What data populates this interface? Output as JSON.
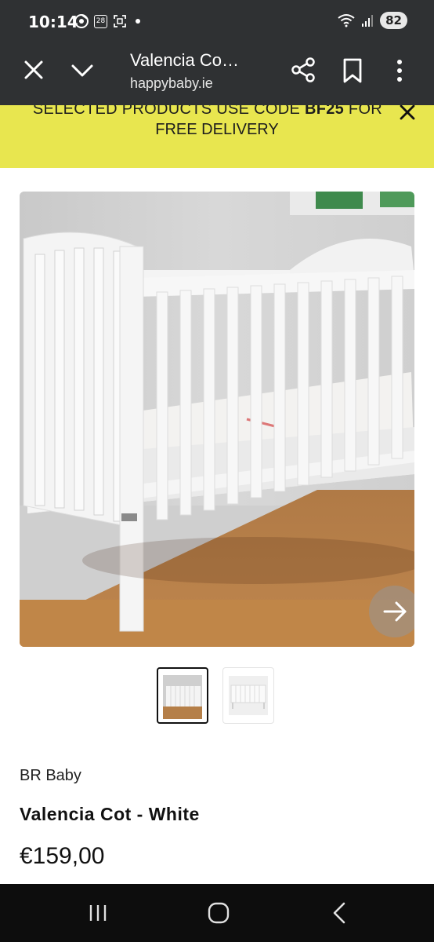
{
  "status_bar": {
    "time": "10:14",
    "calendar_day": "28",
    "battery": "82"
  },
  "browser": {
    "page_title": "Valencia Co…",
    "url": "happybaby.ie"
  },
  "promo": {
    "line1_prefix": "SELECTED PRODUCTS USE CODE ",
    "code": "BF25",
    "line1_suffix": " FOR",
    "line2": "FREE DELIVERY"
  },
  "product": {
    "brand": "BR Baby",
    "title": "Valencia Cot - White",
    "price": "€159,00"
  },
  "colors": {
    "promo_bg": "#e8e64f",
    "toolbar_bg": "#2f3133",
    "nav_bg": "#0d0d0d"
  }
}
